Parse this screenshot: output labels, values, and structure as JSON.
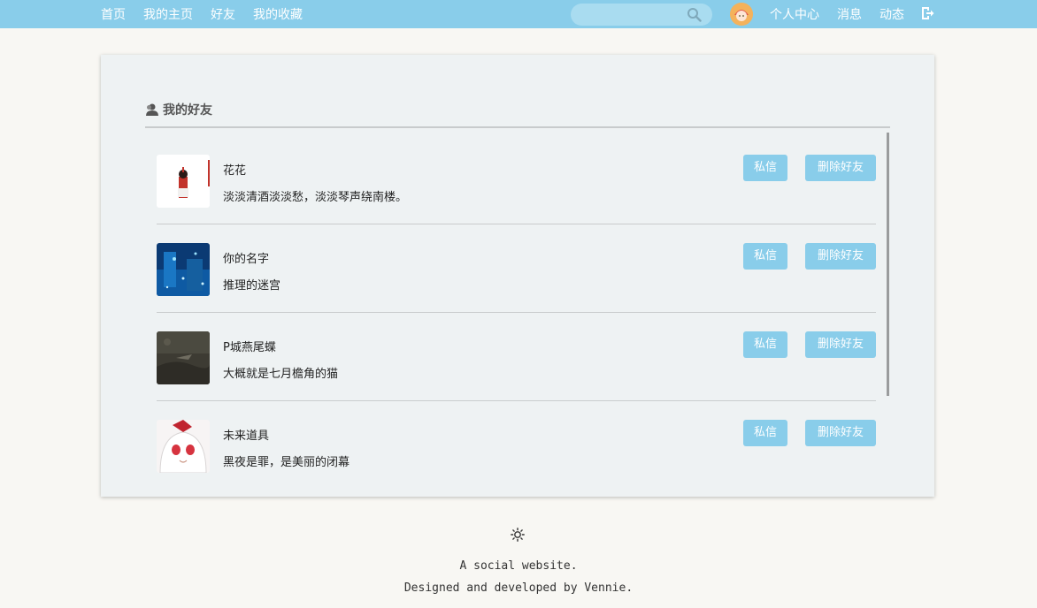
{
  "nav": {
    "left_links": [
      "首页",
      "我的主页",
      "好友",
      "我的收藏"
    ],
    "search_placeholder": "",
    "right_links": [
      "个人中心",
      "消息",
      "动态"
    ],
    "icons": {
      "search": "search-icon",
      "avatar": "user-avatar",
      "logout": "logout-icon"
    }
  },
  "colors": {
    "nav_bg": "#89cdea",
    "button": "#89cdea",
    "card_bg": "#eef2f3",
    "page_bg": "#f8f7f3"
  },
  "section": {
    "title": "我的好友",
    "icon": "user-icon"
  },
  "friends": [
    {
      "name": "花花",
      "signature": "淡淡清酒淡淡愁，淡淡琴声绕南楼。",
      "message_label": "私信",
      "delete_label": "删除好友"
    },
    {
      "name": "你的名字",
      "signature": "推理的迷宫",
      "message_label": "私信",
      "delete_label": "删除好友"
    },
    {
      "name": "P城燕尾蝶",
      "signature": "大概就是七月檐角的猫",
      "message_label": "私信",
      "delete_label": "删除好友"
    },
    {
      "name": "未来道具",
      "signature": "黑夜是罪，是美丽的闭幕",
      "message_label": "私信",
      "delete_label": "删除好友"
    }
  ],
  "footer": {
    "icon": "sun-icon",
    "line1": "A social website.",
    "line2": "Designed and developed by Vennie."
  }
}
